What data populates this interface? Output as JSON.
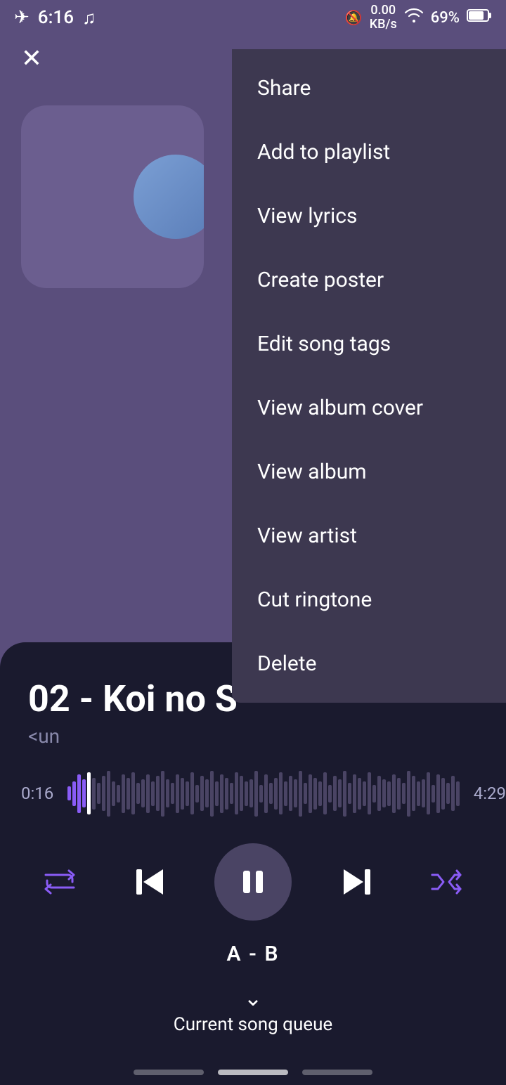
{
  "statusBar": {
    "time": "6:16",
    "musicNote": "♫",
    "networkSpeed": "0.00\nKB/s",
    "wifiStrength": "wifi",
    "battery": "69%"
  },
  "closeButton": "✕",
  "contextMenu": {
    "items": [
      {
        "id": "share",
        "label": "Share"
      },
      {
        "id": "add-to-playlist",
        "label": "Add to playlist"
      },
      {
        "id": "view-lyrics",
        "label": "View lyrics"
      },
      {
        "id": "create-poster",
        "label": "Create poster"
      },
      {
        "id": "edit-song-tags",
        "label": "Edit song tags"
      },
      {
        "id": "view-album-cover",
        "label": "View album cover"
      },
      {
        "id": "view-album",
        "label": "View album"
      },
      {
        "id": "view-artist",
        "label": "View artist"
      },
      {
        "id": "cut-ringtone",
        "label": "Cut ringtone"
      },
      {
        "id": "delete",
        "label": "Delete"
      }
    ]
  },
  "player": {
    "songTitle": "02 - Koi no S",
    "songSubtitle": "<un",
    "currentTime": "0:16",
    "totalTime": "4:29",
    "abLabel": "A - B",
    "queueLabel": "Current song queue"
  },
  "controls": {
    "repeat": "repeat",
    "previous": "prev",
    "pause": "pause",
    "next": "next",
    "shuffle": "shuffle"
  }
}
